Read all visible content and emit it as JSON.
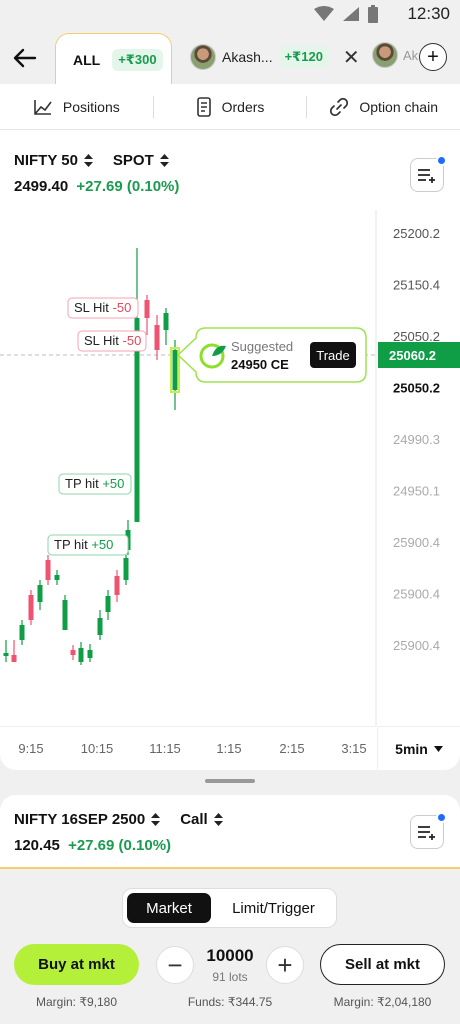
{
  "status": {
    "time": "12:30"
  },
  "tabs": {
    "all": {
      "label": "ALL",
      "pnl": "+₹300"
    },
    "user1": {
      "name": "Akash...",
      "pnl": "+₹120"
    },
    "user2": {
      "name": "Ak"
    }
  },
  "nav": {
    "positions": "Positions",
    "orders": "Orders",
    "option_chain": "Option chain"
  },
  "instrument": {
    "name": "NIFTY 50",
    "type": "SPOT",
    "price": "2499.40",
    "change": "+27.69 (0.10%)"
  },
  "chart": {
    "y_labels": [
      "25200.2",
      "25150.4",
      "25050.2",
      "25050.2",
      "24990.3",
      "24950.1",
      "25900.4",
      "25900.4",
      "25900.4"
    ],
    "current_price": "25060.2",
    "x_labels": [
      "9:15",
      "10:15",
      "11:15",
      "1:15",
      "2:15",
      "3:15"
    ],
    "interval": "5min",
    "markers": [
      {
        "label": "SL Hit",
        "value": "-50",
        "kind": "loss"
      },
      {
        "label": "SL Hit",
        "value": "-50",
        "kind": "loss"
      },
      {
        "label": "TP hit",
        "value": "+50",
        "kind": "profit"
      },
      {
        "label": "TP hit",
        "value": "+50",
        "kind": "profit"
      }
    ],
    "suggestion": {
      "title": "Suggested",
      "contract": "24950 CE",
      "action": "Trade"
    }
  },
  "chart_data": {
    "type": "candlestick",
    "up_color": "#0f9d46",
    "down_color": "#f05370",
    "candles": [
      {
        "o": 25908,
        "h": 25912,
        "l": 25896,
        "c": 25902,
        "dir": "up"
      },
      {
        "o": 25914,
        "h": 25918,
        "l": 25896,
        "c": 25898,
        "dir": "down"
      },
      {
        "o": 25911,
        "h": 25925,
        "l": 25905,
        "c": 25921,
        "dir": "up"
      },
      {
        "o": 25937,
        "h": 25940,
        "l": 25912,
        "c": 25916,
        "dir": "down"
      },
      {
        "o": 25930,
        "h": 25948,
        "l": 25924,
        "c": 25944,
        "dir": "up"
      },
      {
        "o": 25966,
        "h": 25970,
        "l": 25938,
        "c": 25946,
        "dir": "down"
      },
      {
        "o": 25950,
        "h": 25966,
        "l": 25948,
        "c": 25960,
        "dir": "up"
      },
      {
        "o": 25936,
        "h": 25941,
        "l": 25900,
        "c": 25912,
        "dir": "up"
      },
      {
        "o": 25905,
        "h": 25912,
        "l": 25896,
        "c": 25900,
        "dir": "down"
      },
      {
        "o": 25900,
        "h": 25912,
        "l": 25894,
        "c": 25908,
        "dir": "up"
      },
      {
        "o": 25906,
        "h": 25913,
        "l": 25894,
        "c": 25901,
        "dir": "up"
      },
      {
        "o": 25916,
        "h": 25924,
        "l": 25908,
        "c": 25920,
        "dir": "up"
      },
      {
        "o": 25934,
        "h": 25945,
        "l": 25930,
        "c": 25938,
        "dir": "up"
      },
      {
        "o": 25952,
        "h": 25957,
        "l": 25938,
        "c": 25940,
        "dir": "down"
      },
      {
        "o": 25944,
        "h": 25975,
        "l": 25940,
        "c": 25970,
        "dir": "up"
      },
      {
        "o": 25980,
        "h": 26000,
        "l": 25974,
        "c": 25995,
        "dir": "up"
      },
      {
        "o": 25995,
        "h": 25190,
        "l": 25990,
        "c": 25128,
        "dir": "up"
      },
      {
        "o": 25128,
        "h": 25138,
        "l": 25095,
        "c": 25104,
        "dir": "down"
      },
      {
        "o": 25102,
        "h": 25108,
        "l": 25060,
        "c": 25076,
        "dir": "down"
      },
      {
        "o": 25086,
        "h": 25115,
        "l": 25075,
        "c": 25102,
        "dir": "up"
      },
      {
        "o": 25060,
        "h": 25070,
        "l": 25014,
        "c": 25030,
        "dir": "up"
      }
    ]
  },
  "option": {
    "name": "NIFTY 16SEP 2500",
    "type": "Call",
    "price": "120.45",
    "change": "+27.69 (0.10%)"
  },
  "order": {
    "market": "Market",
    "limit": "Limit/Trigger",
    "buy": "Buy at mkt",
    "sell": "Sell at mkt",
    "qty": "10000",
    "lots": "91 lots",
    "margin_buy": "Margin: ₹9,180",
    "funds": "Funds: ₹344.75",
    "margin_sell": "Margin: ₹2,04,180"
  }
}
